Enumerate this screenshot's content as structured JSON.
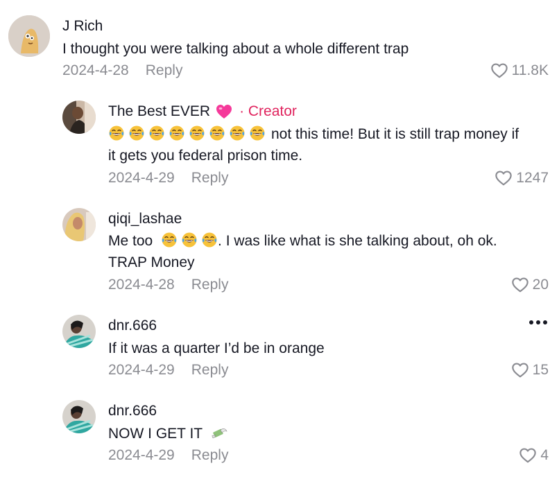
{
  "comments": [
    {
      "username": "J Rich",
      "text": "I thought you were talking about a whole different trap",
      "date": "2024-4-28",
      "reply_label": "Reply",
      "likes": "11.8K"
    },
    {
      "username": "The Best EVER",
      "creator_label": "· Creator",
      "text_line1": "not this time! But it is still trap money if",
      "text_line2": "it gets you federal prison time.",
      "date": "2024-4-29",
      "reply_label": "Reply",
      "likes": "1247"
    },
    {
      "username": "qiqi_lashae",
      "text_before": "Me too",
      "text_after": ". I was like what is she talking about, oh ok.",
      "text_line2": "TRAP Money",
      "date": "2024-4-28",
      "reply_label": "Reply",
      "likes": "20"
    },
    {
      "username": "dnr.666",
      "text": "If it was a quarter I’d be in orange",
      "date": "2024-4-29",
      "reply_label": "Reply",
      "likes": "15"
    },
    {
      "username": "dnr.666",
      "text": "NOW I GET IT",
      "date": "2024-4-29",
      "reply_label": "Reply",
      "likes": "4"
    }
  ],
  "icons": {
    "like": "heart-outline-icon",
    "more": "more-options-icon",
    "creator_heart": "pink-heart-emoji",
    "laugh": "tears-of-joy-emoji",
    "money": "money-with-wings-emoji"
  },
  "colors": {
    "creator_accent": "#e0245e",
    "meta_gray": "#8a8b91",
    "text": "#161823"
  }
}
